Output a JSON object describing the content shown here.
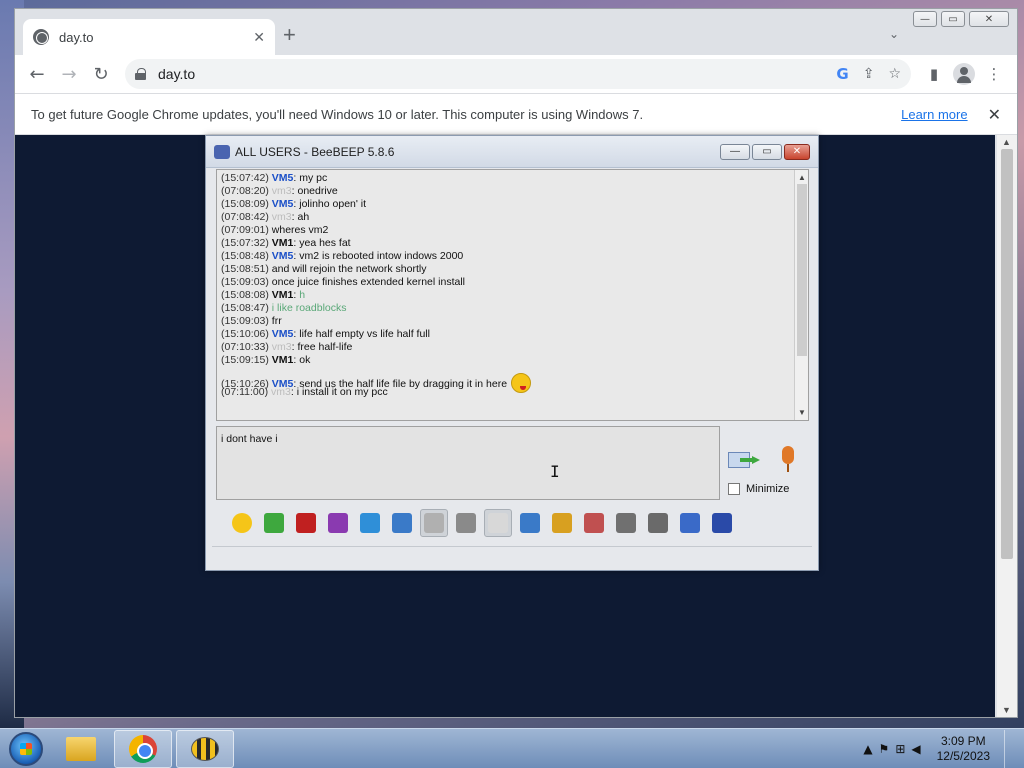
{
  "browser": {
    "tab": {
      "title": "day.to"
    },
    "address": {
      "url": "day.to"
    },
    "infobar": {
      "message": "To get future Google Chrome updates, you'll need Windows 10 or later. This computer is using Windows 7.",
      "learn_more": "Learn more"
    },
    "icons": {
      "back": "←",
      "forward": "→",
      "reload": "↻",
      "google": "G",
      "share": "⇪",
      "star": "☆",
      "sidepanel": "▮",
      "menu": "⋮",
      "close": "✕",
      "new_tab": "+",
      "tab_list": "⌄"
    }
  },
  "window_controls": {
    "minimize": "—",
    "maximize": "▭",
    "close": "✕"
  },
  "beebeep": {
    "title": "ALL USERS - BeeBEEP 5.8.6",
    "buttons": {
      "minimize": "—",
      "restore": "▭",
      "close": "✕"
    },
    "messages": [
      {
        "time": "(15:07:42)",
        "user": "VM5",
        "sep": ": ",
        "text": "my pc",
        "style": "blue"
      },
      {
        "time": "(07:08:20)",
        "user": "vm3",
        "sep": ": ",
        "text": "onedrive",
        "style": "grey"
      },
      {
        "time": "(15:08:09)",
        "user": "VM5",
        "sep": ": ",
        "text": "jolinho open' it",
        "style": "blue"
      },
      {
        "time": "(07:08:42)",
        "user": "vm3",
        "sep": ": ",
        "text": "ah",
        "style": "grey"
      },
      {
        "time": "(07:09:01)",
        "user": "",
        "sep": "",
        "text": "wheres vm2",
        "style": "cont"
      },
      {
        "time": "(15:07:32)",
        "user": "VM1",
        "sep": ": ",
        "text": "yea hes fat",
        "style": "dark"
      },
      {
        "time": "(15:08:48)",
        "user": "VM5",
        "sep": ": ",
        "text": "vm2 is rebooted intow indows 2000",
        "style": "blue"
      },
      {
        "time": "(15:08:51)",
        "user": "",
        "sep": "",
        "text": "and will rejoin the network shortly",
        "style": "cont"
      },
      {
        "time": "(15:09:03)",
        "user": "",
        "sep": "",
        "text": "once juice finishes extended kernel install",
        "style": "cont"
      },
      {
        "time": "(15:08:08)",
        "user": "VM1",
        "sep": ": ",
        "text": "h",
        "style": "dark-green"
      },
      {
        "time": "(15:08:47)",
        "user": "",
        "sep": "",
        "text": "i like roadblocks",
        "style": "cont-green"
      },
      {
        "time": "(15:09:03)",
        "user": "",
        "sep": "",
        "text": "frr",
        "style": "cont"
      },
      {
        "time": "(15:10:06)",
        "user": "VM5",
        "sep": ": ",
        "text": "life half empty vs life half full",
        "style": "blue"
      },
      {
        "time": "(07:10:33)",
        "user": "vm3",
        "sep": ": ",
        "text": "free half-life",
        "style": "grey"
      },
      {
        "time": "(15:09:15)",
        "user": "VM1",
        "sep": ": ",
        "text": "ok",
        "style": "dark"
      },
      {
        "time": "(15:10:26)",
        "user": "VM5",
        "sep": ": ",
        "text": "send us the half life file by dragging it in here",
        "style": "blue",
        "emoji": "wink-face-icon"
      },
      {
        "time": "(07:11:00)",
        "user": "vm3",
        "sep": ": ",
        "text": "i install it on my pcc",
        "style": "grey"
      }
    ],
    "input_value": "i dont have i",
    "minimize_label": "Minimize",
    "toolbar_icons": [
      "emoticon-icon",
      "bee-send-icon",
      "text-format-icon",
      "pen-color-icon",
      "filter-icon",
      "settings-gears-icon",
      "spellcheck-icon",
      "font-icon",
      "note-icon",
      "send-file-icon",
      "share-folder-icon",
      "html-icon",
      "record-icon",
      "screenshot-icon",
      "edit-note-icon",
      "save-icon"
    ],
    "pressed_toolbar": [
      "spellcheck-icon",
      "note-icon"
    ]
  },
  "taskbar": {
    "clock_time": "3:09 PM",
    "clock_date": "12/5/2023",
    "tray_icons": {
      "show_hidden": "▲",
      "action_center": "⚑",
      "network": "⊞",
      "volume": "◀"
    }
  }
}
